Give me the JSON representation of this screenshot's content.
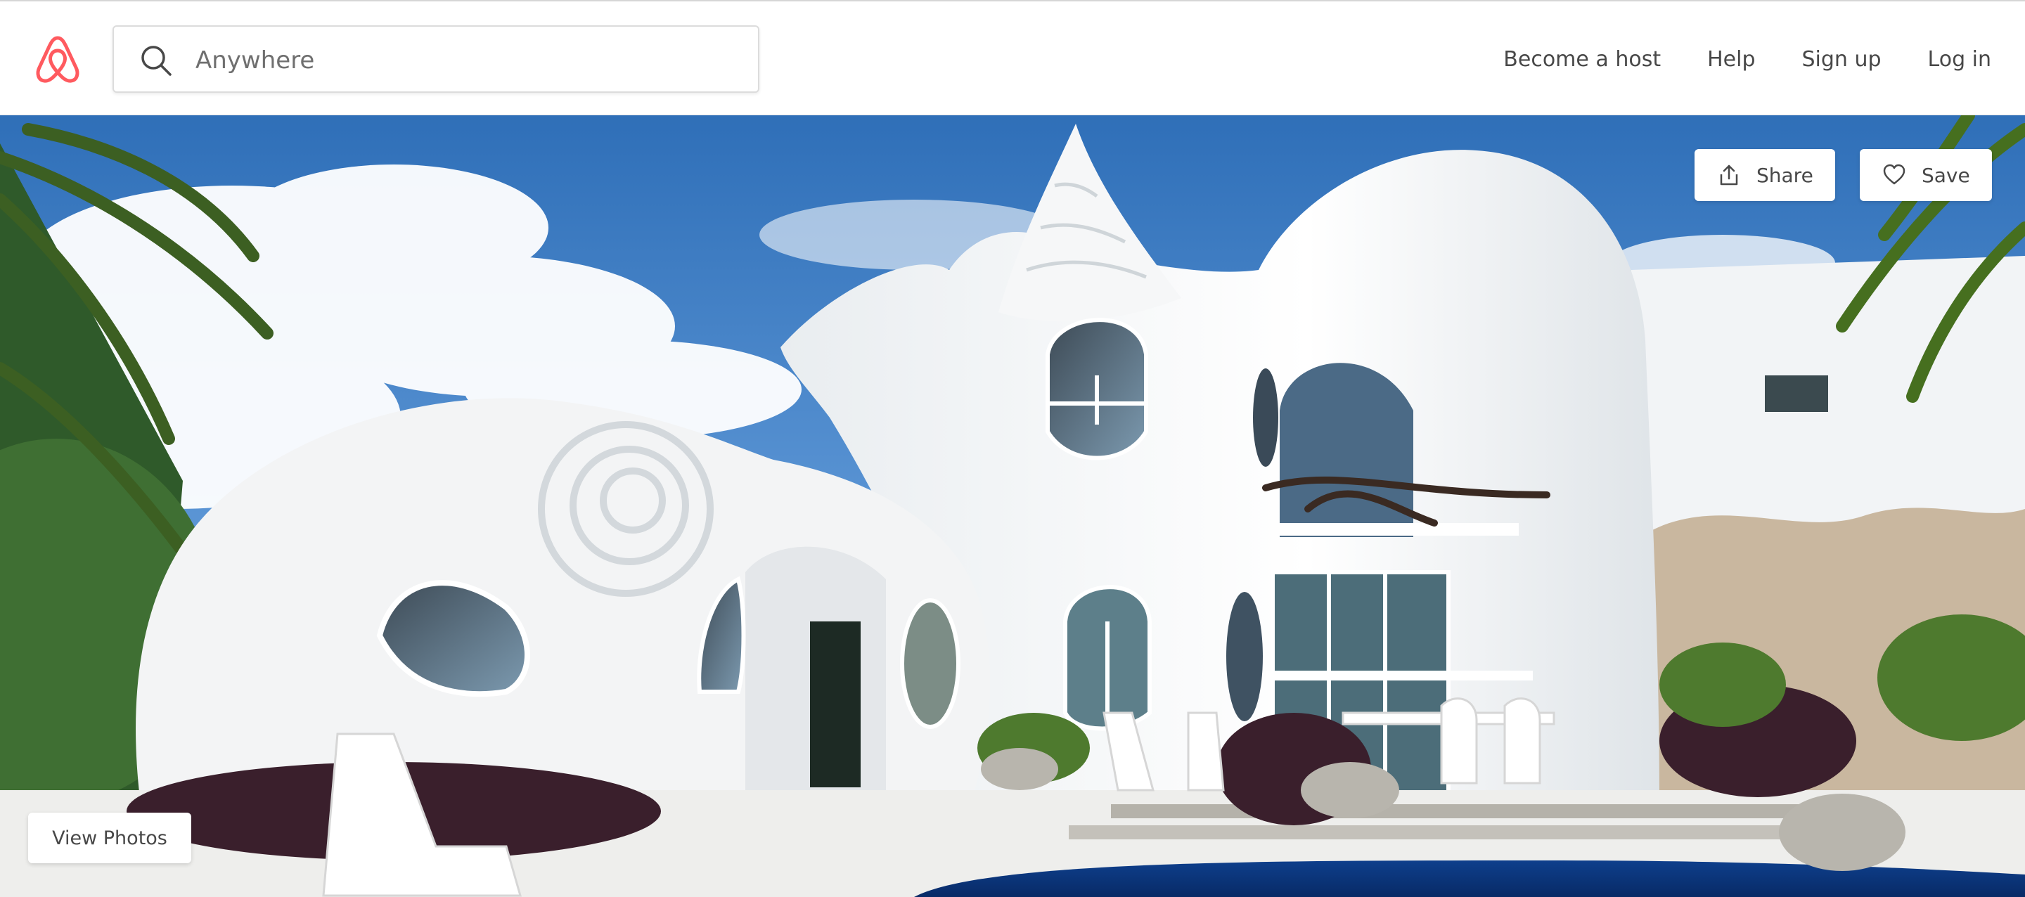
{
  "brand": {
    "name": "Airbnb",
    "color": "#FF5A5F"
  },
  "search": {
    "placeholder": "Anywhere",
    "value": "",
    "icon": "search-icon"
  },
  "nav": {
    "items": [
      {
        "label": "Become a host"
      },
      {
        "label": "Help"
      },
      {
        "label": "Sign up"
      },
      {
        "label": "Log in"
      }
    ]
  },
  "hero": {
    "share_label": "Share",
    "share_icon": "share-icon",
    "save_label": "Save",
    "save_icon": "heart-icon",
    "view_photos_label": "View Photos"
  }
}
